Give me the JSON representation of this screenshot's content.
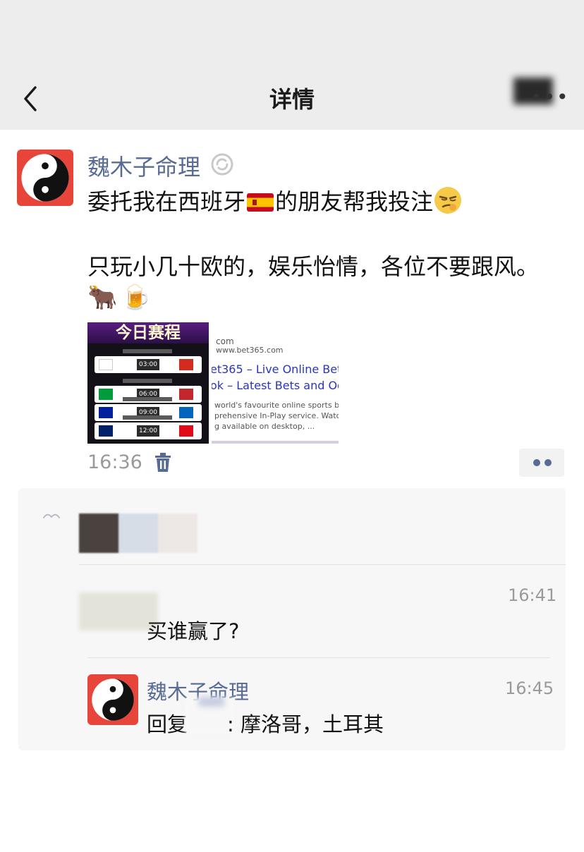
{
  "header": {
    "title": "详情",
    "back_icon": "chevron-left-icon",
    "more_label": "•••"
  },
  "post": {
    "author": "魏木子命理",
    "text_line1_a": "委托我在西班牙",
    "text_line1_b": "的朋友帮我投注",
    "text_line2": "只玩小几十欧的，娱乐怡情，各位不要跟风。",
    "emojis": [
      "🐂",
      "🍺"
    ],
    "time": "16:36",
    "images": {
      "schedule": {
        "title": "今日赛程",
        "times": [
          "03:00",
          "06:00",
          "09:00",
          "12:00"
        ]
      },
      "link_preview": {
        "domain": "com",
        "url": "www.bet365.com",
        "title_line1": "et365 – Live Online Bet",
        "title_line2": "ok – Latest Bets and Od",
        "desc_line1": "world's favourite online sports bett",
        "desc_line2": "prehensive In-Play service. Watch",
        "desc_line3": "g available on desktop, ..."
      }
    }
  },
  "comments": [
    {
      "time": "16:41",
      "text": "买谁赢了?"
    },
    {
      "author": "魏木子命理",
      "time": "16:45",
      "reply_prefix": "回复",
      "reply_text": ": 摩洛哥，土耳其"
    }
  ],
  "colors": {
    "link_blue": "#576b95",
    "header_bg": "#ededed",
    "avatar_red": "#e7453a"
  }
}
